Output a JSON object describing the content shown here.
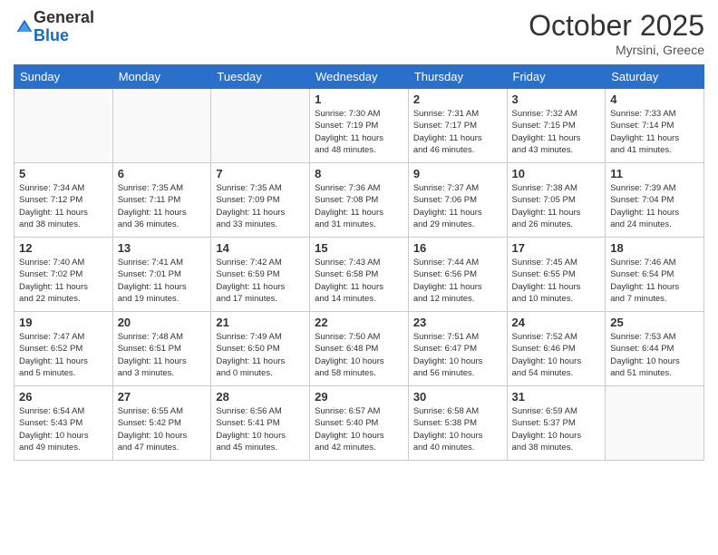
{
  "logo": {
    "general": "General",
    "blue": "Blue"
  },
  "title": "October 2025",
  "location": "Myrsini, Greece",
  "days_of_week": [
    "Sunday",
    "Monday",
    "Tuesday",
    "Wednesday",
    "Thursday",
    "Friday",
    "Saturday"
  ],
  "weeks": [
    [
      {
        "day": "",
        "info": ""
      },
      {
        "day": "",
        "info": ""
      },
      {
        "day": "",
        "info": ""
      },
      {
        "day": "1",
        "info": "Sunrise: 7:30 AM\nSunset: 7:19 PM\nDaylight: 11 hours\nand 48 minutes."
      },
      {
        "day": "2",
        "info": "Sunrise: 7:31 AM\nSunset: 7:17 PM\nDaylight: 11 hours\nand 46 minutes."
      },
      {
        "day": "3",
        "info": "Sunrise: 7:32 AM\nSunset: 7:15 PM\nDaylight: 11 hours\nand 43 minutes."
      },
      {
        "day": "4",
        "info": "Sunrise: 7:33 AM\nSunset: 7:14 PM\nDaylight: 11 hours\nand 41 minutes."
      }
    ],
    [
      {
        "day": "5",
        "info": "Sunrise: 7:34 AM\nSunset: 7:12 PM\nDaylight: 11 hours\nand 38 minutes."
      },
      {
        "day": "6",
        "info": "Sunrise: 7:35 AM\nSunset: 7:11 PM\nDaylight: 11 hours\nand 36 minutes."
      },
      {
        "day": "7",
        "info": "Sunrise: 7:35 AM\nSunset: 7:09 PM\nDaylight: 11 hours\nand 33 minutes."
      },
      {
        "day": "8",
        "info": "Sunrise: 7:36 AM\nSunset: 7:08 PM\nDaylight: 11 hours\nand 31 minutes."
      },
      {
        "day": "9",
        "info": "Sunrise: 7:37 AM\nSunset: 7:06 PM\nDaylight: 11 hours\nand 29 minutes."
      },
      {
        "day": "10",
        "info": "Sunrise: 7:38 AM\nSunset: 7:05 PM\nDaylight: 11 hours\nand 26 minutes."
      },
      {
        "day": "11",
        "info": "Sunrise: 7:39 AM\nSunset: 7:04 PM\nDaylight: 11 hours\nand 24 minutes."
      }
    ],
    [
      {
        "day": "12",
        "info": "Sunrise: 7:40 AM\nSunset: 7:02 PM\nDaylight: 11 hours\nand 22 minutes."
      },
      {
        "day": "13",
        "info": "Sunrise: 7:41 AM\nSunset: 7:01 PM\nDaylight: 11 hours\nand 19 minutes."
      },
      {
        "day": "14",
        "info": "Sunrise: 7:42 AM\nSunset: 6:59 PM\nDaylight: 11 hours\nand 17 minutes."
      },
      {
        "day": "15",
        "info": "Sunrise: 7:43 AM\nSunset: 6:58 PM\nDaylight: 11 hours\nand 14 minutes."
      },
      {
        "day": "16",
        "info": "Sunrise: 7:44 AM\nSunset: 6:56 PM\nDaylight: 11 hours\nand 12 minutes."
      },
      {
        "day": "17",
        "info": "Sunrise: 7:45 AM\nSunset: 6:55 PM\nDaylight: 11 hours\nand 10 minutes."
      },
      {
        "day": "18",
        "info": "Sunrise: 7:46 AM\nSunset: 6:54 PM\nDaylight: 11 hours\nand 7 minutes."
      }
    ],
    [
      {
        "day": "19",
        "info": "Sunrise: 7:47 AM\nSunset: 6:52 PM\nDaylight: 11 hours\nand 5 minutes."
      },
      {
        "day": "20",
        "info": "Sunrise: 7:48 AM\nSunset: 6:51 PM\nDaylight: 11 hours\nand 3 minutes."
      },
      {
        "day": "21",
        "info": "Sunrise: 7:49 AM\nSunset: 6:50 PM\nDaylight: 11 hours\nand 0 minutes."
      },
      {
        "day": "22",
        "info": "Sunrise: 7:50 AM\nSunset: 6:48 PM\nDaylight: 10 hours\nand 58 minutes."
      },
      {
        "day": "23",
        "info": "Sunrise: 7:51 AM\nSunset: 6:47 PM\nDaylight: 10 hours\nand 56 minutes."
      },
      {
        "day": "24",
        "info": "Sunrise: 7:52 AM\nSunset: 6:46 PM\nDaylight: 10 hours\nand 54 minutes."
      },
      {
        "day": "25",
        "info": "Sunrise: 7:53 AM\nSunset: 6:44 PM\nDaylight: 10 hours\nand 51 minutes."
      }
    ],
    [
      {
        "day": "26",
        "info": "Sunrise: 6:54 AM\nSunset: 5:43 PM\nDaylight: 10 hours\nand 49 minutes."
      },
      {
        "day": "27",
        "info": "Sunrise: 6:55 AM\nSunset: 5:42 PM\nDaylight: 10 hours\nand 47 minutes."
      },
      {
        "day": "28",
        "info": "Sunrise: 6:56 AM\nSunset: 5:41 PM\nDaylight: 10 hours\nand 45 minutes."
      },
      {
        "day": "29",
        "info": "Sunrise: 6:57 AM\nSunset: 5:40 PM\nDaylight: 10 hours\nand 42 minutes."
      },
      {
        "day": "30",
        "info": "Sunrise: 6:58 AM\nSunset: 5:38 PM\nDaylight: 10 hours\nand 40 minutes."
      },
      {
        "day": "31",
        "info": "Sunrise: 6:59 AM\nSunset: 5:37 PM\nDaylight: 10 hours\nand 38 minutes."
      },
      {
        "day": "",
        "info": ""
      }
    ]
  ]
}
